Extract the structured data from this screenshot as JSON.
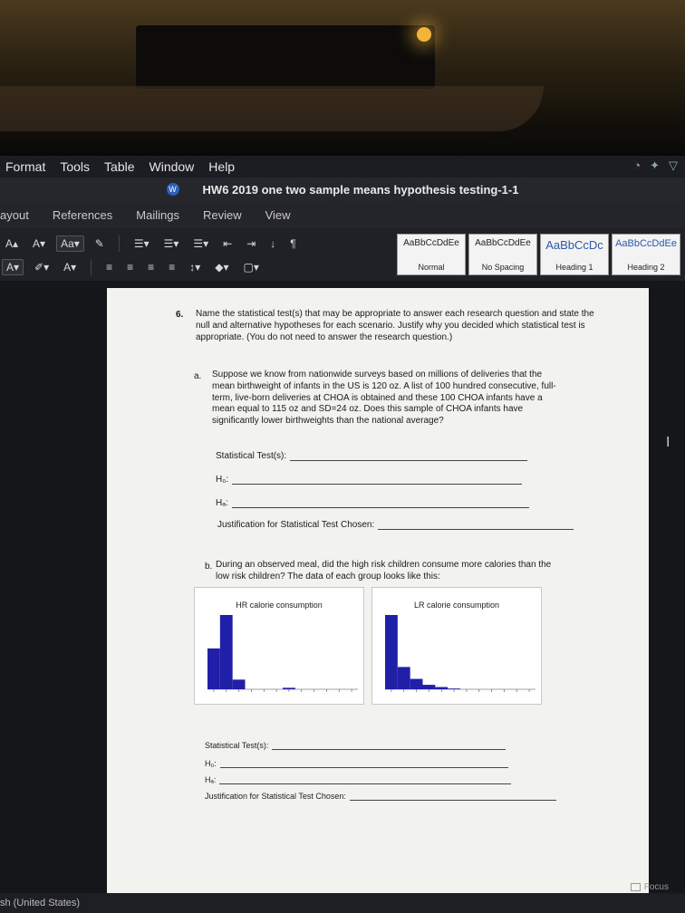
{
  "menubar": {
    "items": [
      "Format",
      "Tools",
      "Table",
      "Window",
      "Help"
    ]
  },
  "window": {
    "title": "HW6 2019 one two sample means hypothesis testing-1-1"
  },
  "ribbon": {
    "tabs": [
      "ayout",
      "References",
      "Mailings",
      "Review",
      "View"
    ],
    "styles": [
      {
        "preview": "AaBbCcDdEe",
        "name": "Normal"
      },
      {
        "preview": "AaBbCcDdEe",
        "name": "No Spacing"
      },
      {
        "preview": "AaBbCcDc",
        "name": "Heading 1"
      },
      {
        "preview": "AaBbCcDdEe",
        "name": "Heading 2"
      }
    ]
  },
  "document": {
    "q6_number": "6.",
    "q6_text": "Name the statistical test(s) that may be appropriate to answer each research question and state the null and alternative hypotheses for each scenario. Justify why you decided which statistical test is appropriate. (You do not need to answer the research question.)",
    "part_a": {
      "label": "a.",
      "text": "Suppose we know from nationwide surveys based on millions of deliveries that the mean birthweight of infants in the US is 120 oz. A list of 100 hundred consecutive, full-term, live-born deliveries at CHOA is obtained and these 100 CHOA infants have a mean equal to 115 oz and SD=24 oz. Does this sample of CHOA infants have significantly lower birthweights than the national average?",
      "statistical_tests": "Statistical Test(s):",
      "h0": "H₀:",
      "ha": "Hₐ:",
      "justification": "Justification for Statistical Test Chosen:"
    },
    "part_b": {
      "label": "b.",
      "text": "During an observed meal, did the high risk children consume more calories than the low risk children? The data of each group looks like this:",
      "statistical_tests": "Statistical Test(s):",
      "h0": "H₀:",
      "ha": "Hₐ:",
      "justification": "Justification for Statistical Test Chosen:"
    }
  },
  "chart_data": [
    {
      "type": "bar",
      "title": "HR calorie consumption",
      "values": [
        0.55,
        1.0,
        0.13,
        0.0,
        0.0,
        0.0,
        0.02,
        0.0,
        0.0,
        0.0,
        0.0,
        0.0
      ],
      "color": "#1f1fa8"
    },
    {
      "type": "bar",
      "title": "LR calorie consumption",
      "values": [
        1.0,
        0.3,
        0.14,
        0.06,
        0.03,
        0.01,
        0.0,
        0.0,
        0.0,
        0.0,
        0.0,
        0.0
      ],
      "color": "#1f1fa8"
    }
  ],
  "status": {
    "language": "sh (United States)",
    "focus": "Focus"
  }
}
